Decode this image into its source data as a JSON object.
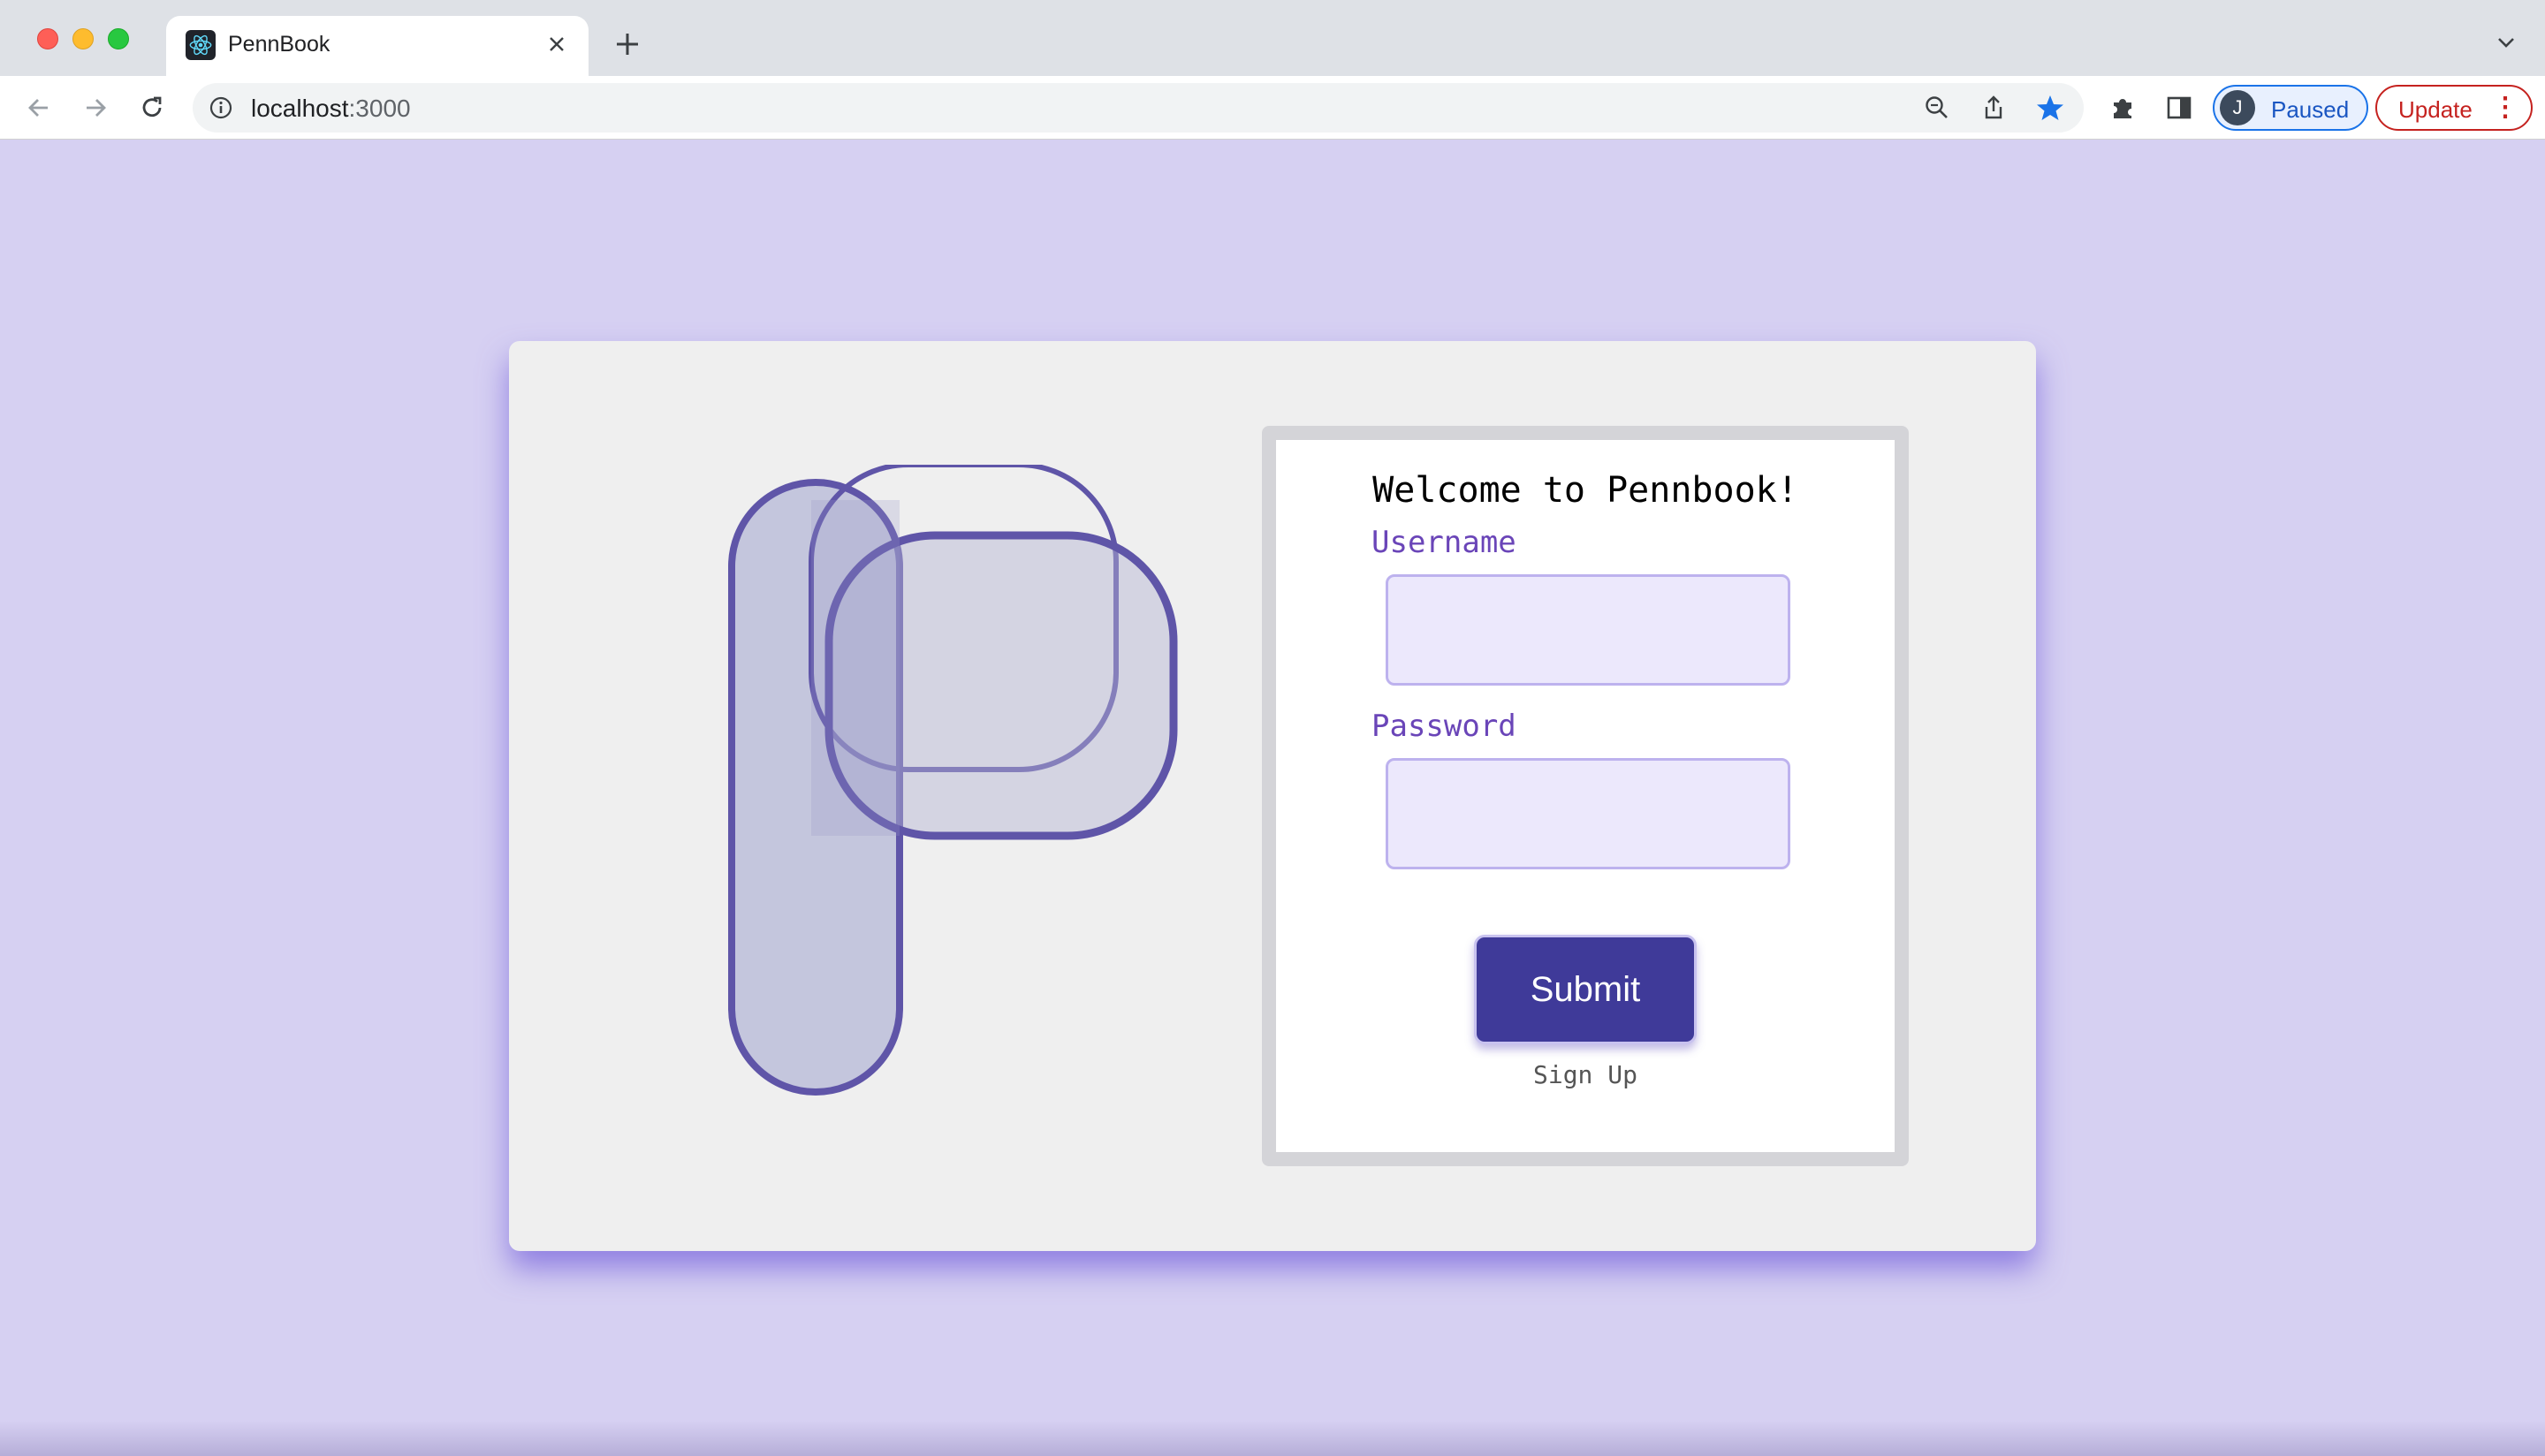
{
  "browser": {
    "tab": {
      "title": "PennBook",
      "favicon": "react-icon"
    },
    "new_tab_label": "+",
    "address": {
      "host": "localhost",
      "port": ":3000"
    },
    "profile": {
      "initial": "J",
      "label": "Paused"
    },
    "update": {
      "label": "Update"
    }
  },
  "login": {
    "welcome": "Welcome to Pennbook!",
    "username_label": "Username",
    "username_value": "",
    "password_label": "Password",
    "password_value": "",
    "submit_label": "Submit",
    "signup_label": "Sign Up"
  },
  "colors": {
    "page_background": "#d6d0f2",
    "card_background": "#efefef",
    "accent": "#3f3a99",
    "label": "#6a45b8",
    "logo_stroke": "#5f55a8"
  }
}
